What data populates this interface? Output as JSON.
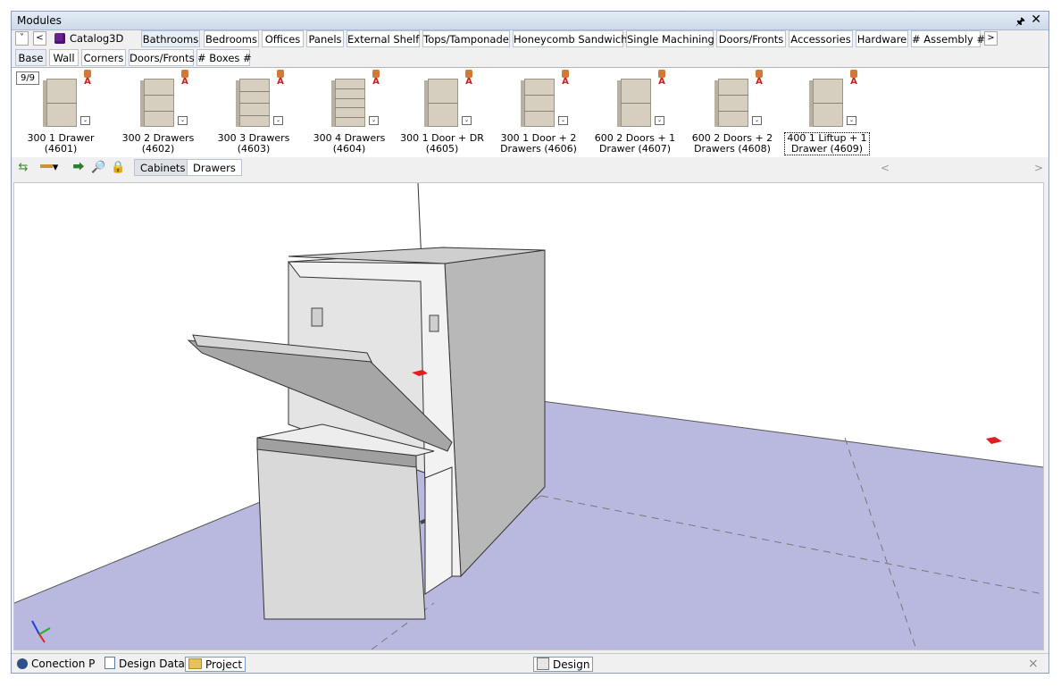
{
  "window": {
    "title": "Modules",
    "pin_glyph": "P",
    "close_glyph": "✕"
  },
  "catalog_tabs": {
    "nav_down": "˅",
    "nav_left": "<",
    "nav_right": ">",
    "items": [
      {
        "label": "Catalog3D",
        "selected": false
      },
      {
        "label": "Bathrooms",
        "selected": true
      },
      {
        "label": "Bedrooms",
        "selected": false
      },
      {
        "label": "Offices",
        "selected": false
      },
      {
        "label": "Panels",
        "selected": false
      },
      {
        "label": "External Shelf",
        "selected": false
      },
      {
        "label": "Tops/Tamponade",
        "selected": false
      },
      {
        "label": "Honeycomb Sandwich",
        "selected": false
      },
      {
        "label": "Single Machining",
        "selected": false
      },
      {
        "label": "Doors/Fronts",
        "selected": false
      },
      {
        "label": "Accessories",
        "selected": false
      },
      {
        "label": "Hardware",
        "selected": false
      },
      {
        "label": "# Assembly #",
        "selected": false
      }
    ]
  },
  "sub_tabs": [
    {
      "label": "Base",
      "selected": true
    },
    {
      "label": "Wall",
      "selected": false
    },
    {
      "label": "Corners",
      "selected": false
    },
    {
      "label": "Doors/Fronts",
      "selected": false
    },
    {
      "label": "# Boxes #",
      "selected": false
    }
  ],
  "gallery": {
    "counter": "9/9",
    "items": [
      {
        "label": "300 1 Drawer (4601)",
        "lines": 1
      },
      {
        "label": "300 2 Drawers (4602)",
        "lines": 2
      },
      {
        "label": "300 3 Drawers (4603)",
        "lines": 3
      },
      {
        "label": "300 4 Drawers (4604)",
        "lines": 4
      },
      {
        "label": "300 1 Door + DR (4605)",
        "lines": 1
      },
      {
        "label": "300 1 Door + 2 Drawers (4606)",
        "lines": 2
      },
      {
        "label": "600 2 Doors + 1 Drawer (4607)",
        "lines": 1
      },
      {
        "label": "600 2 Doors + 2 Drawers (4608)",
        "lines": 2
      },
      {
        "label": "400 1 Liftup + 1 Drawer (4609)",
        "lines": 1
      }
    ]
  },
  "view_tabs": [
    {
      "label": "Cabinets",
      "selected": true
    },
    {
      "label": "Drawers",
      "selected": false
    }
  ],
  "scroll": {
    "left": "<",
    "right": ">"
  },
  "status": {
    "connection": "Conection P",
    "design_data": "Design Data",
    "project": "Project",
    "design": "Design",
    "close": "×"
  },
  "colors": {
    "floor": "#b9b9e0",
    "accent": "#6a1f92",
    "title_bg": "#d6e0ef"
  }
}
